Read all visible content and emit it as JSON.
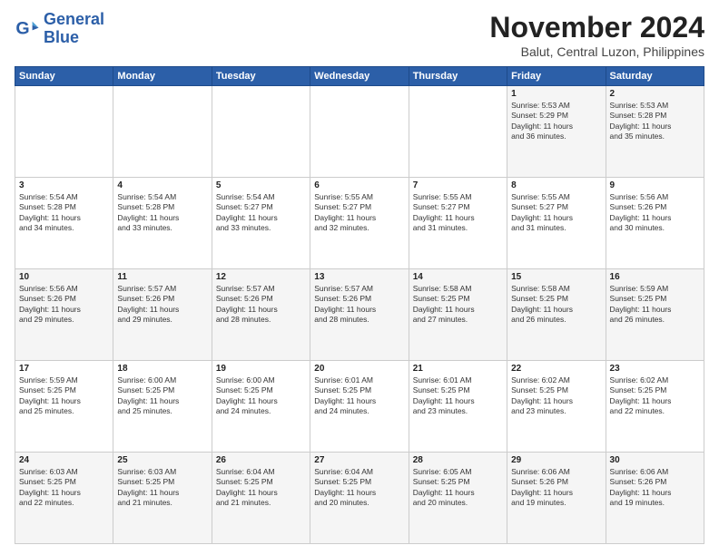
{
  "logo": {
    "line1": "General",
    "line2": "Blue"
  },
  "title": "November 2024",
  "subtitle": "Balut, Central Luzon, Philippines",
  "weekdays": [
    "Sunday",
    "Monday",
    "Tuesday",
    "Wednesday",
    "Thursday",
    "Friday",
    "Saturday"
  ],
  "weeks": [
    [
      {
        "day": "",
        "info": ""
      },
      {
        "day": "",
        "info": ""
      },
      {
        "day": "",
        "info": ""
      },
      {
        "day": "",
        "info": ""
      },
      {
        "day": "",
        "info": ""
      },
      {
        "day": "1",
        "info": "Sunrise: 5:53 AM\nSunset: 5:29 PM\nDaylight: 11 hours\nand 36 minutes."
      },
      {
        "day": "2",
        "info": "Sunrise: 5:53 AM\nSunset: 5:28 PM\nDaylight: 11 hours\nand 35 minutes."
      }
    ],
    [
      {
        "day": "3",
        "info": "Sunrise: 5:54 AM\nSunset: 5:28 PM\nDaylight: 11 hours\nand 34 minutes."
      },
      {
        "day": "4",
        "info": "Sunrise: 5:54 AM\nSunset: 5:28 PM\nDaylight: 11 hours\nand 33 minutes."
      },
      {
        "day": "5",
        "info": "Sunrise: 5:54 AM\nSunset: 5:27 PM\nDaylight: 11 hours\nand 33 minutes."
      },
      {
        "day": "6",
        "info": "Sunrise: 5:55 AM\nSunset: 5:27 PM\nDaylight: 11 hours\nand 32 minutes."
      },
      {
        "day": "7",
        "info": "Sunrise: 5:55 AM\nSunset: 5:27 PM\nDaylight: 11 hours\nand 31 minutes."
      },
      {
        "day": "8",
        "info": "Sunrise: 5:55 AM\nSunset: 5:27 PM\nDaylight: 11 hours\nand 31 minutes."
      },
      {
        "day": "9",
        "info": "Sunrise: 5:56 AM\nSunset: 5:26 PM\nDaylight: 11 hours\nand 30 minutes."
      }
    ],
    [
      {
        "day": "10",
        "info": "Sunrise: 5:56 AM\nSunset: 5:26 PM\nDaylight: 11 hours\nand 29 minutes."
      },
      {
        "day": "11",
        "info": "Sunrise: 5:57 AM\nSunset: 5:26 PM\nDaylight: 11 hours\nand 29 minutes."
      },
      {
        "day": "12",
        "info": "Sunrise: 5:57 AM\nSunset: 5:26 PM\nDaylight: 11 hours\nand 28 minutes."
      },
      {
        "day": "13",
        "info": "Sunrise: 5:57 AM\nSunset: 5:26 PM\nDaylight: 11 hours\nand 28 minutes."
      },
      {
        "day": "14",
        "info": "Sunrise: 5:58 AM\nSunset: 5:25 PM\nDaylight: 11 hours\nand 27 minutes."
      },
      {
        "day": "15",
        "info": "Sunrise: 5:58 AM\nSunset: 5:25 PM\nDaylight: 11 hours\nand 26 minutes."
      },
      {
        "day": "16",
        "info": "Sunrise: 5:59 AM\nSunset: 5:25 PM\nDaylight: 11 hours\nand 26 minutes."
      }
    ],
    [
      {
        "day": "17",
        "info": "Sunrise: 5:59 AM\nSunset: 5:25 PM\nDaylight: 11 hours\nand 25 minutes."
      },
      {
        "day": "18",
        "info": "Sunrise: 6:00 AM\nSunset: 5:25 PM\nDaylight: 11 hours\nand 25 minutes."
      },
      {
        "day": "19",
        "info": "Sunrise: 6:00 AM\nSunset: 5:25 PM\nDaylight: 11 hours\nand 24 minutes."
      },
      {
        "day": "20",
        "info": "Sunrise: 6:01 AM\nSunset: 5:25 PM\nDaylight: 11 hours\nand 24 minutes."
      },
      {
        "day": "21",
        "info": "Sunrise: 6:01 AM\nSunset: 5:25 PM\nDaylight: 11 hours\nand 23 minutes."
      },
      {
        "day": "22",
        "info": "Sunrise: 6:02 AM\nSunset: 5:25 PM\nDaylight: 11 hours\nand 23 minutes."
      },
      {
        "day": "23",
        "info": "Sunrise: 6:02 AM\nSunset: 5:25 PM\nDaylight: 11 hours\nand 22 minutes."
      }
    ],
    [
      {
        "day": "24",
        "info": "Sunrise: 6:03 AM\nSunset: 5:25 PM\nDaylight: 11 hours\nand 22 minutes."
      },
      {
        "day": "25",
        "info": "Sunrise: 6:03 AM\nSunset: 5:25 PM\nDaylight: 11 hours\nand 21 minutes."
      },
      {
        "day": "26",
        "info": "Sunrise: 6:04 AM\nSunset: 5:25 PM\nDaylight: 11 hours\nand 21 minutes."
      },
      {
        "day": "27",
        "info": "Sunrise: 6:04 AM\nSunset: 5:25 PM\nDaylight: 11 hours\nand 20 minutes."
      },
      {
        "day": "28",
        "info": "Sunrise: 6:05 AM\nSunset: 5:25 PM\nDaylight: 11 hours\nand 20 minutes."
      },
      {
        "day": "29",
        "info": "Sunrise: 6:06 AM\nSunset: 5:26 PM\nDaylight: 11 hours\nand 19 minutes."
      },
      {
        "day": "30",
        "info": "Sunrise: 6:06 AM\nSunset: 5:26 PM\nDaylight: 11 hours\nand 19 minutes."
      }
    ]
  ]
}
